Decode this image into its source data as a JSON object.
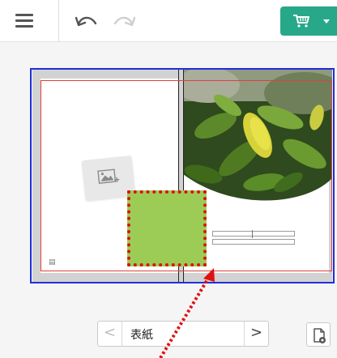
{
  "toolbar": {
    "menu_icon": "hamburger-menu-icon",
    "undo_icon": "undo-icon",
    "redo_icon": "redo-icon",
    "cart_icon": "cart-icon",
    "cart_color": "#27a889"
  },
  "canvas": {
    "border_color": "#1f2fdc",
    "guide_color": "#e04040",
    "placeholder_icon": "image-placeholder-icon",
    "sticker_color": "#9ccc55",
    "sticker_outline_color": "#e01010"
  },
  "page_nav": {
    "prev": "<",
    "current": "表紙",
    "next": ">"
  },
  "settings_icon": "page-settings-icon",
  "annotation": {
    "arrow_color": "#e01010"
  }
}
